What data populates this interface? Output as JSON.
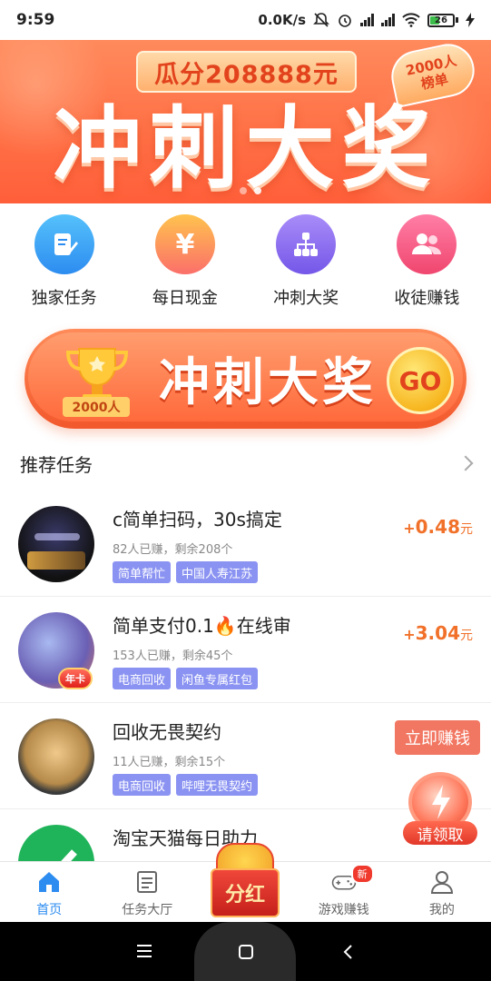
{
  "status_bar": {
    "time": "9:59",
    "net_speed": "0.0K/s",
    "battery": "26"
  },
  "banner": {
    "prize_text": "瓜分208888元",
    "rank_line1": "2000人",
    "rank_line2": "榜单",
    "title": "冲刺大奖"
  },
  "categories": [
    {
      "label": "独家任务",
      "icon": "document-edit-icon",
      "color": "#3aa4f0"
    },
    {
      "label": "每日现金",
      "icon": "yen-icon",
      "color": "#fb9d3d"
    },
    {
      "label": "冲刺大奖",
      "icon": "flowchart-icon",
      "color": "#8f6ff3"
    },
    {
      "label": "收徒赚钱",
      "icon": "users-icon",
      "color": "#f5588c"
    }
  ],
  "cta": {
    "trophy_label": "2000人",
    "title": "冲刺大奖",
    "go": "GO"
  },
  "section": {
    "title": "推荐任务"
  },
  "tasks": [
    {
      "title": "c简单扫码，30s搞定",
      "meta": "82人已赚，剩余208个",
      "tags": [
        "简单帮忙",
        "中国人寿江苏"
      ],
      "reward_plus": "+",
      "reward": "0.48",
      "unit": "元"
    },
    {
      "title": "简单支付0.1🔥在线审",
      "meta": "153人已赚，剩余45个",
      "tags": [
        "电商回收",
        "闲鱼专属红包"
      ],
      "reward_plus": "+",
      "reward": "3.04",
      "unit": "元",
      "badge": "年卡"
    },
    {
      "title": "回收无畏契约",
      "meta": "11人已赚，剩余15个",
      "tags": [
        "电商回收",
        "哔哩无畏契约"
      ],
      "reward_plus": "",
      "reward": "",
      "unit": ""
    },
    {
      "title": "淘宝天猫每日助力",
      "meta": "",
      "tags": [],
      "reward_plus": "",
      "reward": "",
      "unit": ""
    }
  ],
  "floating": {
    "earn_now": "立即赚钱",
    "claim": "请领取"
  },
  "bottom_nav": {
    "items": [
      {
        "label": "首页",
        "icon": "home-icon"
      },
      {
        "label": "任务大厅",
        "icon": "list-icon"
      },
      {
        "label": "",
        "icon": "red-packet-icon"
      },
      {
        "label": "游戏赚钱",
        "icon": "gamepad-icon"
      },
      {
        "label": "我的",
        "icon": "user-icon"
      }
    ],
    "center_label": "分红",
    "new_badge": "新"
  }
}
